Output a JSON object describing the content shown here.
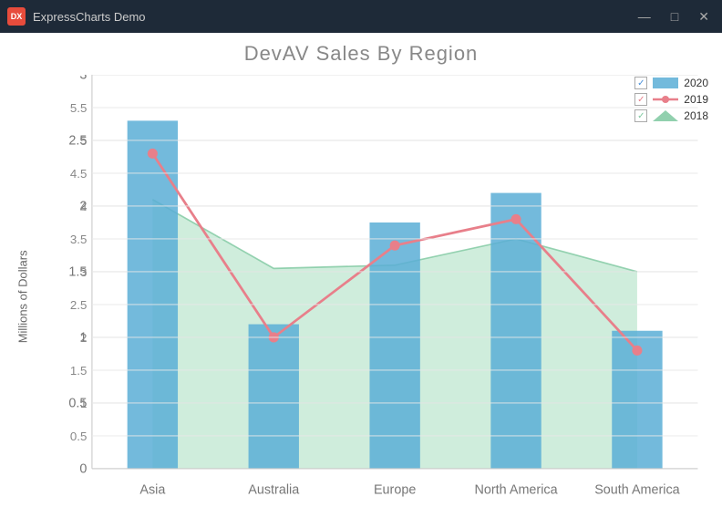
{
  "window": {
    "title": "ExpressCharts Demo",
    "icon_label": "DX",
    "controls": [
      "—",
      "□",
      "✕"
    ]
  },
  "chart": {
    "title": "DevAV Sales By Region",
    "y_axis_label": "Millions of Dollars",
    "y_ticks": [
      "5.5",
      "5",
      "4.5",
      "4",
      "3.5",
      "3",
      "2.5",
      "2",
      "1.5",
      "1",
      "0.5"
    ],
    "x_categories": [
      "Asia",
      "Australia",
      "Europe",
      "North America",
      "South America"
    ],
    "legend": [
      {
        "year": "2020",
        "type": "bar",
        "color": "#5baed6"
      },
      {
        "year": "2019",
        "type": "line",
        "color": "#e87f8a"
      },
      {
        "year": "2018",
        "type": "area",
        "color": "#7ec8a0"
      }
    ],
    "data_2020": [
      5.3,
      2.2,
      3.75,
      4.2,
      2.1
    ],
    "data_2019": [
      4.8,
      2.0,
      3.4,
      3.8,
      1.8
    ],
    "data_2018": [
      4.1,
      3.05,
      3.1,
      3.5,
      3.0
    ]
  }
}
